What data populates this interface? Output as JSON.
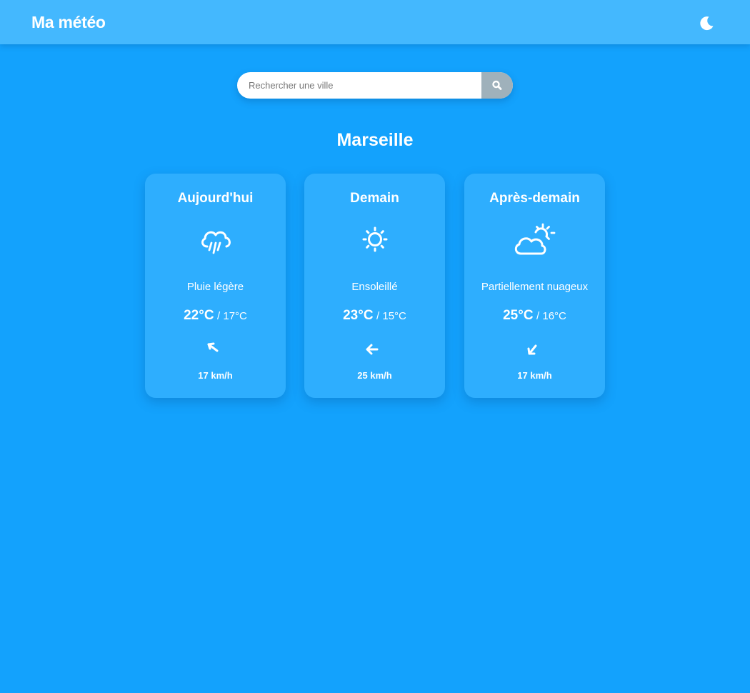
{
  "app": {
    "title": "Ma météo",
    "theme_toggle_icon": "moon-icon"
  },
  "search": {
    "placeholder": "Rechercher une ville",
    "value": "",
    "button_icon": "search-icon"
  },
  "city": "Marseille",
  "colors": {
    "background": "#13a2fd",
    "header": "#44b8fe",
    "card": "#2eaefe",
    "search_button": "#9fb1bb",
    "text": "#ffffff"
  },
  "forecast": [
    {
      "day": "Aujourd'hui",
      "icon": "rain-cloud-icon",
      "description": "Pluie légère",
      "temp_max": "22°C",
      "temp_min": "17°C",
      "wind_direction_icon": "arrow-up-left-icon",
      "wind_speed": "17 km/h"
    },
    {
      "day": "Demain",
      "icon": "sun-icon",
      "description": "Ensoleillé",
      "temp_max": "23°C",
      "temp_min": "15°C",
      "wind_direction_icon": "arrow-left-icon",
      "wind_speed": "25 km/h"
    },
    {
      "day": "Après-demain",
      "icon": "partly-cloudy-icon",
      "description": "Partiellement nuageux",
      "temp_max": "25°C",
      "temp_min": "16°C",
      "wind_direction_icon": "arrow-down-left-icon",
      "wind_speed": "17 km/h"
    }
  ]
}
